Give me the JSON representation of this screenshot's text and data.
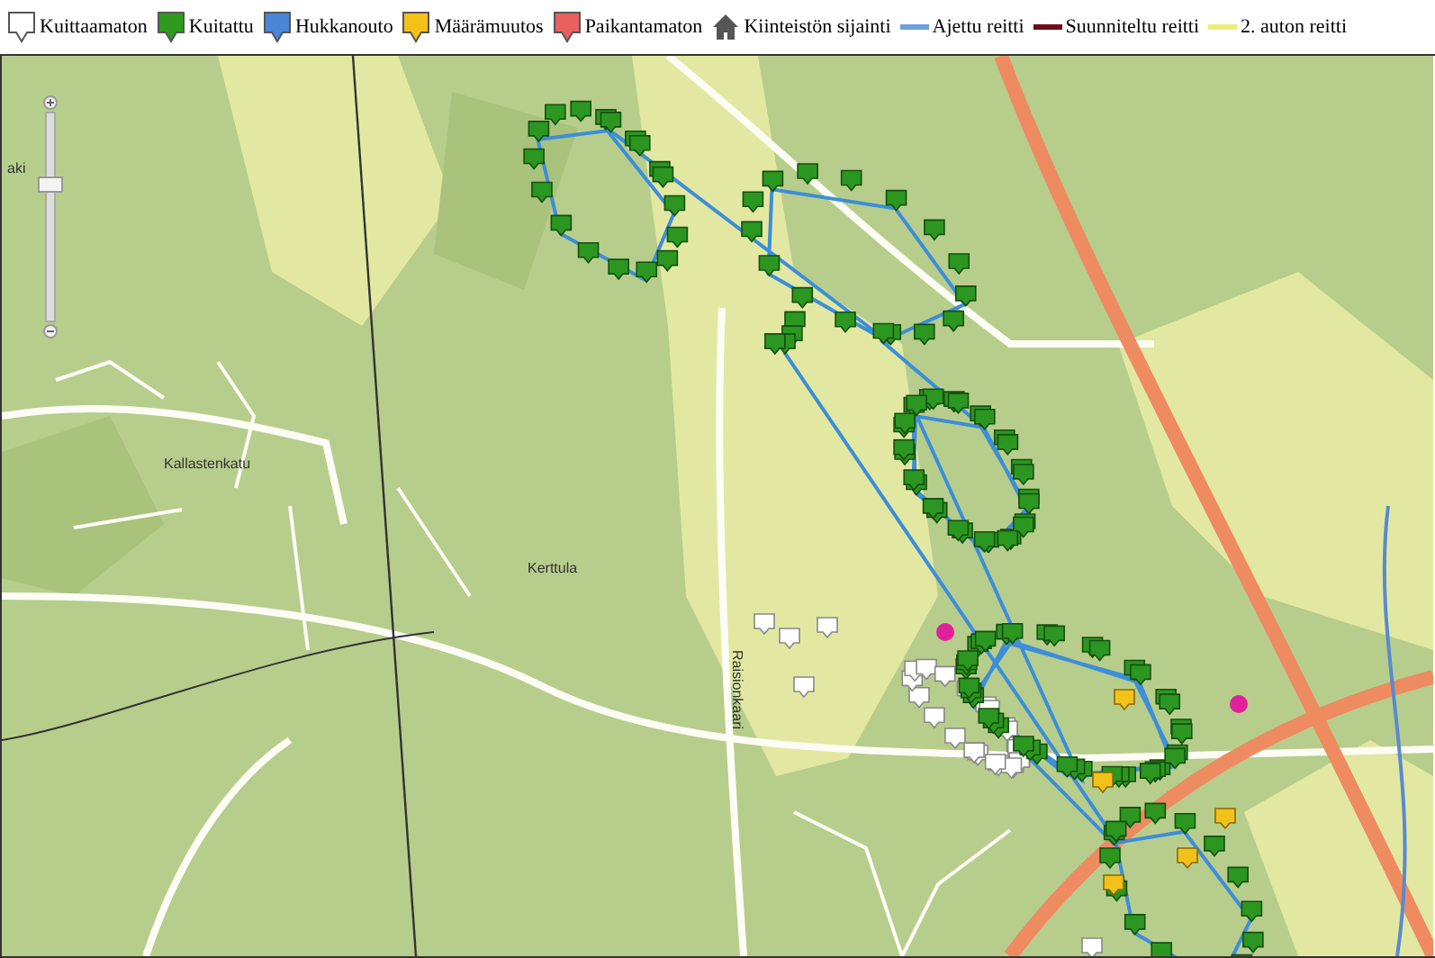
{
  "legend": [
    {
      "label": "Kuittaamaton",
      "kind": "marker",
      "color": "#ffffff"
    },
    {
      "label": "Kuitattu",
      "kind": "marker",
      "color": "#2e9a1e"
    },
    {
      "label": "Hukkanouto",
      "kind": "marker",
      "color": "#4a86d8"
    },
    {
      "label": "Määrämuutos",
      "kind": "marker",
      "color": "#f2c21a"
    },
    {
      "label": "Paikantamaton",
      "kind": "marker",
      "color": "#e86060"
    },
    {
      "label": "Kiinteistön sijainti",
      "kind": "house",
      "color": "#555555"
    },
    {
      "label": "Ajettu reitti",
      "kind": "line",
      "color": "#6fa0dc"
    },
    {
      "label": "Suunniteltu reitti",
      "kind": "line",
      "color": "#6b0f1a"
    },
    {
      "label": "2. auton reitti",
      "kind": "line",
      "color": "#e8f07a"
    }
  ],
  "map": {
    "labels": [
      "aki",
      "Kallastenkatu",
      "Kerttula",
      "Raisionkaari"
    ],
    "zoom_slider": {
      "level": 0.66
    }
  }
}
